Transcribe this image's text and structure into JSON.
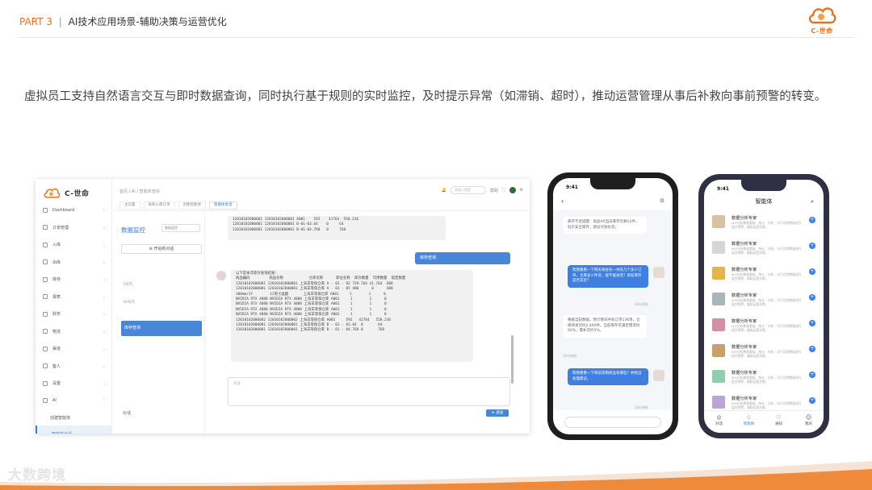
{
  "slide": {
    "part": "PART 3",
    "separator": "|",
    "title": "AI技术应用场景-辅助决策与运营优化",
    "brand_text": "C-世命",
    "intro": "虚拟员工支持自然语言交互与即时数据查询，同时执行基于规则的实时监控，及时提示异常（如滞销、超时），推动运营管理从事后补救向事前预警的转变。",
    "footer_brand": "大数跨境",
    "accent_color": "#e8731f"
  },
  "desktop": {
    "logo_text": "C-世命",
    "breadcrumb": "首页 / AI / 智能体查询",
    "top_search_placeholder": "请输入搜索",
    "top_links": [
      "帮助"
    ],
    "menu": [
      {
        "label": "Dashboard"
      },
      {
        "label": "订单管理"
      },
      {
        "label": "入库"
      },
      {
        "label": "出库"
      },
      {
        "label": "库存"
      },
      {
        "label": "报表"
      },
      {
        "label": "财务"
      },
      {
        "label": "物流"
      },
      {
        "label": "渠道"
      },
      {
        "label": "客人"
      },
      {
        "label": "设置"
      },
      {
        "label": "AI"
      }
    ],
    "submenu": [
      {
        "label": "创建智能体"
      },
      {
        "label": "智能体会话"
      }
    ],
    "tabs": [
      "主页面",
      "采购入库订单",
      "创建智能体",
      "智能体会话"
    ],
    "panel_title": "数据监控",
    "panel_select": "数据监控",
    "new_chat_label": "开始新对话",
    "group_labels": [
      "7天内",
      "30天内"
    ],
    "active_item": "库存查询",
    "panel_footer": "对话",
    "prev_result_lines": [
      "12010102000001 12010102000001 A001    592    41764  550.236",
      "12010102000001 12010102000001 B-01-03.64    0     64",
      "12010102000001 12010102000001 B-01-04.768   0     768"
    ],
    "user_query": "库存查询",
    "result_intro": "以下是本次库存查询结果:",
    "result_header": "商品编码         商品名称            仓库名称      库位名称  库存数量  可用数量  锁定数量",
    "result_rows": [
      "12010102000001 12010102000001 上海羊等保仓库 A - 01 - 02 729.764 41.764  688",
      "12010102000001 12010102000001 上海羊等保仓库 A - 01 - 05 480      0      480",
      "300mm/JY        12英寸晶圆       上海羊等保仓库 A001     1        1      0",
      "NVIDIA RTX 4080 NVIDIA RTX 4080 上海羊等保仓库 A001     1        1      0",
      "NVIDIA RTX 4080 NVIDIA RTX 4080 上海羊等保仓库 A001     1        1      0",
      "NVIDIA RTX 4080 NVIDIA RTX 4080 上海羊等保仓库 A001     1        1      0",
      "NVIDIA RTX 4080 NVIDIA RTX 4080 上海羊等保仓库 A001     1        1      0",
      "12010102000002 12010102000002 上海羊等保仓库 A001     592   41764   550.236",
      "12010102000001 12010102000001 上海羊等保仓库 B - 01 - 03.64  0       64",
      "12010102000001 12010102000001 上海羊等保仓库 B - 01 - 04.768 0       768"
    ],
    "input_placeholder": "发送",
    "send_label": "发送"
  },
  "phone1": {
    "time": "9:41",
    "messages": [
      {
        "side": "left",
        "text": "库存不足提醒：商品XX当前库存仅剩12件，低于安全库存，建议尽快补货。",
        "time": ""
      },
      {
        "side": "right",
        "text": "帮我看看一下明天将会有一共有几个多少订单，仓库多少件货，能不能发完？目前库存是否充足？",
        "time": "10分钟前"
      },
      {
        "side": "left",
        "text": "根据当前数据，预计明日共有订单136单，仓库待发货约2,400件，当前库存可满足需求约92%，需补货约5%。",
        "time": "10分钟前"
      },
      {
        "side": "right",
        "text": "帮我看看一下目前滞销商品有哪些？并给出处理建议。",
        "time": "10分钟前"
      }
    ]
  },
  "phone2": {
    "time": "9:41",
    "title": "智能体",
    "agents": [
      {
        "name": "数据分析专家",
        "desc": "Will分析数据看板、统计、分析、对于异常数据进行监控预警，辅助运营决策。",
        "color": "#d9c2a4"
      },
      {
        "name": "数据分析专家",
        "desc": "Will分析数据看板、统计、分析、对于异常数据进行监控预警，辅助运营决策。",
        "color": "#d6d6d6"
      },
      {
        "name": "数据分析专家",
        "desc": "Will分析数据看板、统计、分析、对于异常数据进行监控预警，辅助运营决策。",
        "color": "#e3b54a"
      },
      {
        "name": "数据分析专家",
        "desc": "Will分析数据看板、统计、分析、对于异常数据进行监控预警，辅助运营决策。",
        "color": "#a7b6b8"
      },
      {
        "name": "数据分析专家",
        "desc": "Will分析数据看板、统计、分析、对于异常数据进行监控预警，辅助运营决策。",
        "color": "#d48fa4"
      },
      {
        "name": "数据分析专家",
        "desc": "Will分析数据看板、统计、分析、对于异常数据进行监控预警，辅助运营决策。",
        "color": "#c9a06a"
      },
      {
        "name": "数据分析专家",
        "desc": "Will分析数据看板、统计、分析、对于异常数据进行监控预警，辅助运营决策。",
        "color": "#8fcfb0"
      },
      {
        "name": "数据分析专家",
        "desc": "Will分析数据看板、统计、分析、对于异常数据进行监控预警，辅助运营决策。",
        "color": "#b9a6d6"
      }
    ],
    "tabs": [
      {
        "label": "对话",
        "icon": "◎"
      },
      {
        "label": "智能体",
        "icon": "☆"
      },
      {
        "label": "通知",
        "icon": "♡"
      },
      {
        "label": "我的",
        "icon": "☺"
      }
    ],
    "active_tab": 1
  }
}
